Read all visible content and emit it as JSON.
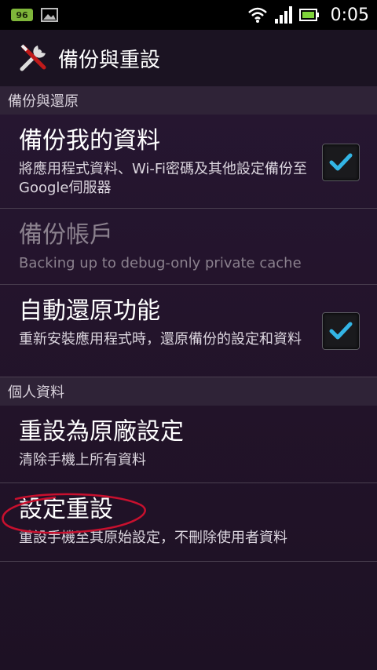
{
  "status_bar": {
    "battery_badge": "96",
    "time": "0:05"
  },
  "action_bar": {
    "title": "備份與重設",
    "icon": "tools-icon"
  },
  "sections": [
    {
      "header": "備份與還原",
      "items": [
        {
          "title": "備份我的資料",
          "summary": "將應用程式資料、Wi-Fi密碼及其他設定備份至Google伺服器",
          "checked": true,
          "enabled": true
        },
        {
          "title": "備份帳戶",
          "summary": "Backing up to debug-only private cache",
          "enabled": false
        },
        {
          "title": "自動還原功能",
          "summary": "重新安裝應用程式時，還原備份的設定和資料",
          "checked": true,
          "enabled": true
        }
      ]
    },
    {
      "header": "個人資料",
      "items": [
        {
          "title": "重設為原廠設定",
          "summary": "清除手機上所有資料",
          "enabled": true
        },
        {
          "title": "設定重設",
          "summary": "重設手機至其原始設定，不刪除使用者資料",
          "enabled": true
        }
      ]
    }
  ],
  "colors": {
    "accent_check": "#33b5e5",
    "annotation_red": "#c8102e",
    "battery_green": "#7fb63a"
  }
}
